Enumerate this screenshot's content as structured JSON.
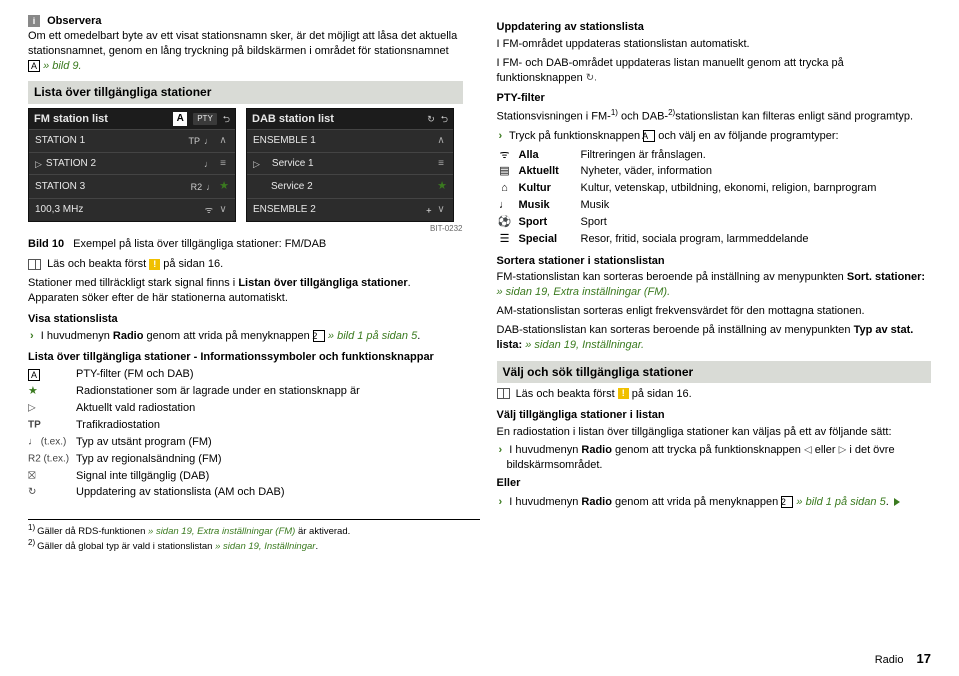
{
  "left": {
    "observe_label": "Observera",
    "observe_text_1": "Om ett omedelbart byte av ett visat stationsnamn sker, är det möjligt att låsa det aktuella stationsnamnet, genom en lång tryckning på bildskärmen i området för stationsnamnet ",
    "observe_box": "A",
    "observe_text_2": " » bild 9.",
    "shade_title": "Lista över tillgängliga stationer",
    "figure": {
      "left": {
        "title": "FM station list",
        "badge_A": "A",
        "badge_pty": "PTY",
        "rows": [
          {
            "name": "STATION 1",
            "right": "TP",
            "fav": false,
            "arrow": "∧"
          },
          {
            "name": "STATION 2",
            "right": "",
            "fav": false,
            "arrow": "≡",
            "play": true
          },
          {
            "name": "STATION 3",
            "right": "R2",
            "fav": true,
            "arrow": ""
          },
          {
            "name": "100,3 MHz",
            "right": "",
            "fav": false,
            "arrow": "∨",
            "masks": true
          }
        ]
      },
      "right": {
        "title": "DAB station list",
        "rows": [
          {
            "name": "ENSEMBLE 1",
            "right": "",
            "fav": false,
            "arrow": "∧"
          },
          {
            "name": "Service 1",
            "right": "",
            "fav": false,
            "arrow": "≡",
            "play": true,
            "indent": true
          },
          {
            "name": "Service 2",
            "right": "",
            "fav": true,
            "arrow": "",
            "indent": true
          },
          {
            "name": "ENSEMBLE 2",
            "right": "",
            "fav": false,
            "arrow": "∨",
            "ant": true
          }
        ]
      },
      "id": "BIT-0232",
      "caption_num": "Bild 10",
      "caption_text": "Exempel på lista över tillgängliga stationer: FM/DAB"
    },
    "read_first_1": "Läs och beakta först ",
    "read_first_2": " på sidan 16.",
    "stations_signal": "Stationer med tillräckligt stark signal finns i ",
    "stations_signal_bold": "Listan över tillgängliga stationer",
    "stations_signal_tail": ". Apparaten söker efter de här stationerna automatiskt.",
    "show_list_h": "Visa stationslista",
    "show_list_text_pre": "I huvudmenyn ",
    "show_list_radio": "Radio",
    "show_list_text_mid": " genom att vrida på menyknappen ",
    "show_list_box": "2",
    "show_list_link": " » bild 1 på sidan 5",
    "show_list_tail": ".",
    "symbols_h": "Lista över tillgängliga stationer - Informationssymboler och funktionsknappar",
    "symbols": [
      {
        "sym": "A_box",
        "text": "PTY-filter (FM och DAB)"
      },
      {
        "sym": "★",
        "green": true,
        "text": "Radionstationer som är lagrade under en stationsknapp är"
      },
      {
        "sym": "▷",
        "text": "Aktuellt vald radiostation"
      },
      {
        "sym": "TP",
        "text": "Trafikradiostation"
      },
      {
        "sym": "♩ (t.ex.)",
        "text": "Typ av utsänt program (FM)"
      },
      {
        "sym": "R2 (t.ex.)",
        "text": "Typ av regionalsändning (FM)"
      },
      {
        "sym": "▨",
        "text": "Signal inte tillgänglig (DAB)"
      },
      {
        "sym": "↻",
        "text": "Uppdatering av stationslista (AM och DAB)"
      }
    ]
  },
  "right": {
    "update_h": "Uppdatering av stationslista",
    "update_fm": "I FM-området uppdateras stationslistan automatiskt.",
    "update_manual_pre": "I FM- och DAB-området uppdateras listan manuellt genom att trycka på funktionsknappen ",
    "update_manual_sym": "↻.",
    "pty_h": "PTY-filter",
    "pty_text_pre": "Stationsvisningen i FM-",
    "pty_sup1": "1)",
    "pty_text_mid": " och DAB-",
    "pty_sup2": "2)",
    "pty_text_tail": "stationslistan kan filteras enligt sänd programtyp.",
    "pty_bullet_pre": "Tryck på funktionsknappen ",
    "pty_bullet_box": "A",
    "pty_bullet_tail": " och välj en av följande programtyper:",
    "pty_table": [
      {
        "icon": "ᯤ",
        "label": "Alla",
        "desc": "Filtreringen är frånslagen."
      },
      {
        "icon": "▤",
        "label": "Aktuellt",
        "desc": "Nyheter, väder, information"
      },
      {
        "icon": "⌂",
        "label": "Kultur",
        "desc": "Kultur, vetenskap, utbildning, ekonomi, religion, barnprogram"
      },
      {
        "icon": "♩",
        "label": "Musik",
        "desc": "Musik"
      },
      {
        "icon": "⚽",
        "label": "Sport",
        "desc": "Sport"
      },
      {
        "icon": "☰",
        "label": "Special",
        "desc": "Resor, fritid, sociala program, larmmeddelande"
      }
    ],
    "sort_h": "Sortera stationer i stationslistan",
    "sort_fm_pre": "FM-stationslistan kan sorteras beroende på inställning av menypunkten ",
    "sort_fm_bold1": "Sort. stationer:",
    "sort_fm_link": " » sidan 19",
    "sort_fm_tail": ", Extra inställningar (FM).",
    "sort_am": "AM-stationslistan sorteras enligt frekvensvärdet för den mottagna stationen.",
    "sort_dab_pre": "DAB-stationslistan kan sorteras beroende på inställning av menypunkten ",
    "sort_dab_bold": "Typ av stat. lista:",
    "sort_dab_link": " » sidan 19",
    "sort_dab_tail": ", Inställningar.",
    "shade_title2": "Välj och sök tillgängliga stationer",
    "read_first2_1": "Läs och beakta först ",
    "read_first2_2": " på sidan 16.",
    "select_h": "Välj tillgängliga stationer i listan",
    "select_text": "En radiostation i listan över tillgängliga stationer kan väljas på ett av följande sätt:",
    "bullet1_pre": "I huvudmenyn ",
    "bullet1_radio": "Radio",
    "bullet1_mid": " genom att trycka på funktionsknappen ",
    "bullet1_sym1": "◁",
    "bullet1_or": " eller ",
    "bullet1_sym2": "▷",
    "bullet1_tail": " i det övre bildskärmsområdet.",
    "eller": "Eller",
    "bullet2_pre": "I huvudmenyn ",
    "bullet2_radio": "Radio",
    "bullet2_mid": " genom att vrida på menyknappen ",
    "bullet2_box": "2",
    "bullet2_link": " » bild 1 på sidan 5",
    "bullet2_tail": "."
  },
  "footnotes": {
    "f1_pre": "Gäller då RDS-funktionen ",
    "f1_link": "» sidan 19, Extra inställningar (FM)",
    "f1_tail": " är aktiverad.",
    "f2_pre": "Gäller då global typ är vald i stationslistan ",
    "f2_link": "» sidan 19, Inställningar",
    "f2_tail": "."
  },
  "footer": {
    "section": "Radio",
    "page": "17"
  }
}
